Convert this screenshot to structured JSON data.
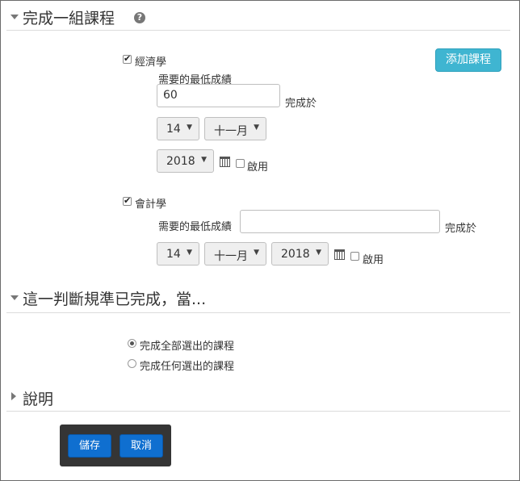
{
  "section1": {
    "title": "完成一組課程",
    "help_icon": "?",
    "add_button": "添加課程",
    "courses": [
      {
        "name": "經濟學",
        "checked": true,
        "min_grade_label": "需要的最低成績",
        "min_grade_value": "60",
        "complete_on_label": "完成於",
        "day": "14",
        "month": "十一月",
        "year": "2018",
        "enable_label": "啟用",
        "enable_checked": false
      },
      {
        "name": "會計學",
        "checked": true,
        "min_grade_label": "需要的最低成績",
        "min_grade_value": "",
        "complete_on_label": "完成於",
        "day": "14",
        "month": "十一月",
        "year": "2018",
        "enable_label": "啟用",
        "enable_checked": false
      }
    ]
  },
  "section2": {
    "title": "這一判斷規準已完成，當...",
    "options": [
      {
        "label": "完成全部選出的課程",
        "selected": true
      },
      {
        "label": "完成任何選出的課程",
        "selected": false
      }
    ]
  },
  "section3": {
    "title": "說明"
  },
  "footer": {
    "save": "儲存",
    "cancel": "取消"
  },
  "icons": {
    "section_expanded": "triangle-down-icon",
    "section_collapsed": "triangle-right-icon",
    "help": "question-circle-icon",
    "calendar": "calendar-icon",
    "dropdown": "chevron-down-icon"
  },
  "colors": {
    "add_button": "#3fb5d1",
    "primary_button": "#0f6fd0",
    "footer_bg": "#353535"
  }
}
